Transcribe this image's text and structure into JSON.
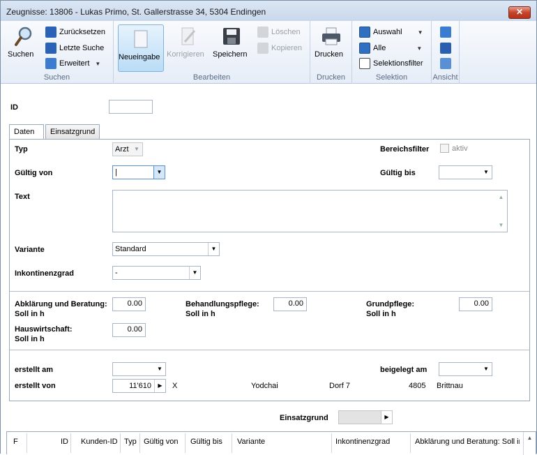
{
  "window": {
    "title": "Zeugnisse: 13806 - Lukas Primo, St. Gallerstrasse 34, 5304 Endingen",
    "close_glyph": "✕"
  },
  "ribbon": {
    "suchen": {
      "search": "Suchen",
      "reset": "Zurücksetzen",
      "last": "Letzte Suche",
      "extended": "Erweitert",
      "group": "Suchen"
    },
    "bearbeiten": {
      "new": "Neueingabe",
      "correct": "Korrigieren",
      "save": "Speichern",
      "delete": "Löschen",
      "copy": "Kopieren",
      "group": "Bearbeiten"
    },
    "drucken": {
      "print": "Drucken",
      "group": "Drucken"
    },
    "selektion": {
      "auswahl": "Auswahl",
      "alle": "Alle",
      "filter": "Selektionsfilter",
      "group": "Selektion"
    },
    "ansicht": {
      "group": "Ansicht"
    }
  },
  "form": {
    "id_label": "ID",
    "id_value": "",
    "tabs": [
      "Daten",
      "Einsatzgrund"
    ],
    "typ_label": "Typ",
    "typ_value": "Arzt",
    "bereichsfilter_label": "Bereichsfilter",
    "bereichsfilter_check": "aktiv",
    "gueltig_von_label": "Gültig von",
    "gueltig_von_value": "|",
    "gueltig_bis_label": "Gültig bis",
    "gueltig_bis_value": "",
    "text_label": "Text",
    "text_value": "",
    "variante_label": "Variante",
    "variante_value": "Standard",
    "inkontinenz_label": "Inkontinenzgrad",
    "inkontinenz_value": "-",
    "abklaerung_label": "Abklärung und Beratung:",
    "abklaerung_sub": "Soll in h",
    "abklaerung_value": "0.00",
    "behandlung_label": "Behandlungspflege:",
    "behandlung_sub": "Soll in h",
    "behandlung_value": "0.00",
    "grundpflege_label": "Grundpflege:",
    "grundpflege_sub": "Soll in h",
    "grundpflege_value": "0.00",
    "hauswirt_label": "Hauswirtschaft:",
    "hauswirt_sub": "Soll in h",
    "hauswirt_value": "0.00",
    "erstellt_am_label": "erstellt am",
    "erstellt_am_value": "",
    "beigelegt_label": "beigelegt am",
    "beigelegt_value": "",
    "erstellt_von_label": "erstellt von",
    "erstellt_von_value": "11'610",
    "erstellt_von_x": "X",
    "person_name": "Yodchai",
    "person_street": "Dorf 7",
    "person_zip": "4805",
    "person_city": "Brittnau"
  },
  "einsatzgrund": {
    "label": "Einsatzgrund",
    "value": ""
  },
  "grid": {
    "columns": [
      "F",
      "ID",
      "Kunden-ID",
      "Typ",
      "Gültig von",
      "Gültig bis",
      "Variante",
      "Inkontinenzgrad",
      "Abklärung und Beratung: Soll in"
    ]
  }
}
